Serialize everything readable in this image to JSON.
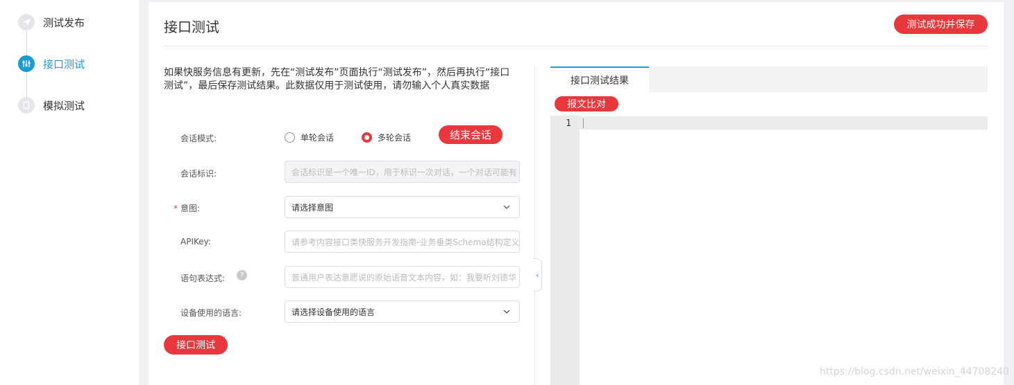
{
  "sidebar": {
    "steps": [
      {
        "label": "测试发布"
      },
      {
        "label": "接口测试"
      },
      {
        "label": "模拟测试"
      }
    ]
  },
  "header": {
    "title": "接口测试",
    "save_button": "测试成功并保存"
  },
  "description": "如果快服务信息有更新，先在“测试发布”页面执行“测试发布”，然后再执行“接口测试”，最后保存测试结果。此数据仅用于测试使用，请勿输入个人真实数据",
  "form": {
    "session_mode": {
      "label": "会话模式:",
      "options": [
        "单轮会话",
        "多轮会话"
      ],
      "selected": "多轮会话",
      "end_button": "结束会话"
    },
    "session_id": {
      "label": "会话标识:",
      "placeholder": "会话标识是一个唯一ID，用于标识一次对话，一个对话可能有"
    },
    "intent": {
      "required_mark": "*",
      "label": "意图:",
      "value": "请选择意图"
    },
    "apikey": {
      "label": "APIKey:",
      "placeholder": "请参考内容接口类快服务开发指南-业务垂类Schema结构定义"
    },
    "utterance": {
      "label": "语句表达式:",
      "help_icon": "?",
      "placeholder": "普通用户表达意愿说的原始语音文本内容，如：我要听刘德华"
    },
    "language": {
      "label": "设备使用的语言:",
      "value": "请选择设备使用的语言"
    },
    "submit_button": "接口测试"
  },
  "results": {
    "tab": "接口测试结果",
    "compare_button": "报文比对",
    "line_number": "1"
  },
  "watermark": "https://blog.csdn.net/weixin_44708240",
  "colors": {
    "accent": "#1a9bd7",
    "brand_red": "#e8383d"
  }
}
